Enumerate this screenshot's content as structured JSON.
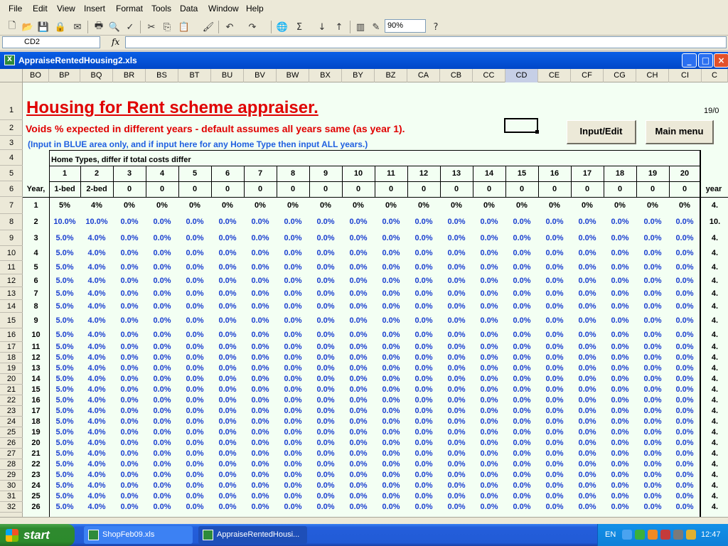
{
  "menu": [
    "File",
    "Edit",
    "View",
    "Insert",
    "Format",
    "Tools",
    "Data",
    "Window",
    "Help"
  ],
  "toolbar": {
    "zoom": "90%"
  },
  "formula_bar": {
    "name_box": "CD2",
    "fx": "fx",
    "formula": ""
  },
  "workbook": {
    "title": "AppraiseRentedHousing2.xls"
  },
  "columns": [
    "BO",
    "BP",
    "BQ",
    "BR",
    "BS",
    "BT",
    "BU",
    "BV",
    "BW",
    "BX",
    "BY",
    "BZ",
    "CA",
    "CB",
    "CC",
    "CD",
    "CE",
    "CF",
    "CG",
    "CH",
    "CI",
    "C"
  ],
  "selected_column": "CD",
  "rows": [
    "1",
    "2",
    "3",
    "4",
    "5",
    "6",
    "7",
    "8",
    "9",
    "10",
    "11",
    "12",
    "13",
    "14",
    "15",
    "16",
    "17",
    "18",
    "19",
    "20",
    "21",
    "22",
    "23",
    "24",
    "25",
    "26",
    "27",
    "28",
    "29",
    "30",
    "31",
    "32"
  ],
  "sheet": {
    "title": "Housing for Rent scheme appraiser.",
    "date_fragment": "19/0",
    "subtitle": "Voids % expected in different years - default assumes all years same (as year 1).",
    "note": "(Input in BLUE area only, and if input here for any Home Type then input ALL years.)",
    "btn_input": "Input/Edit",
    "btn_main": "Main menu",
    "home_types_label": "Home Types,  differ if total costs differ",
    "year_label": "Year,",
    "year_right": "year",
    "type_numbers": [
      "1",
      "2",
      "3",
      "4",
      "5",
      "6",
      "7",
      "8",
      "9",
      "10",
      "11",
      "12",
      "13",
      "14",
      "15",
      "16",
      "17",
      "18",
      "19",
      "20"
    ],
    "type_names": [
      "1-bed",
      "2-bed",
      "0",
      "0",
      "0",
      "0",
      "0",
      "0",
      "0",
      "0",
      "0",
      "0",
      "0",
      "0",
      "0",
      "0",
      "0",
      "0",
      "0",
      "0"
    ],
    "year1_values": [
      "5%",
      "4%",
      "0%",
      "0%",
      "0%",
      "0%",
      "0%",
      "0%",
      "0%",
      "0%",
      "0%",
      "0%",
      "0%",
      "0%",
      "0%",
      "0%",
      "0%",
      "0%",
      "0%",
      "0%"
    ],
    "year2_values": [
      "10.0%",
      "10.0%",
      "0.0%",
      "0.0%",
      "0.0%",
      "0.0%",
      "0.0%",
      "0.0%",
      "0.0%",
      "0.0%",
      "0.0%",
      "0.0%",
      "0.0%",
      "0.0%",
      "0.0%",
      "0.0%",
      "0.0%",
      "0.0%",
      "0.0%",
      "0.0%"
    ],
    "other_year_values": [
      "5.0%",
      "4.0%",
      "0.0%",
      "0.0%",
      "0.0%",
      "0.0%",
      "0.0%",
      "0.0%",
      "0.0%",
      "0.0%",
      "0.0%",
      "0.0%",
      "0.0%",
      "0.0%",
      "0.0%",
      "0.0%",
      "0.0%",
      "0.0%",
      "0.0%",
      "0.0%"
    ],
    "right_fragments": [
      "4.",
      "10.",
      "4.",
      "4.",
      "4.",
      "4.",
      "4.",
      "4.",
      "4.",
      "4.",
      "4.",
      "4.",
      "4.",
      "4.",
      "4.",
      "4.",
      "4.",
      "4.",
      "4.",
      "4.",
      "4.",
      "4.",
      "4.",
      "4.",
      "4.",
      "4."
    ],
    "years": [
      "1",
      "2",
      "3",
      "4",
      "5",
      "6",
      "7",
      "8",
      "9",
      "10",
      "11",
      "12",
      "13",
      "14",
      "15",
      "16",
      "17",
      "18",
      "19",
      "20",
      "21",
      "22",
      "23",
      "24",
      "25",
      "26"
    ]
  },
  "taskbar": {
    "start": "start",
    "tasks": [
      "ShopFeb09.xls",
      "AppraiseRentedHousi..."
    ],
    "lang": "EN",
    "clock": "12:47"
  }
}
